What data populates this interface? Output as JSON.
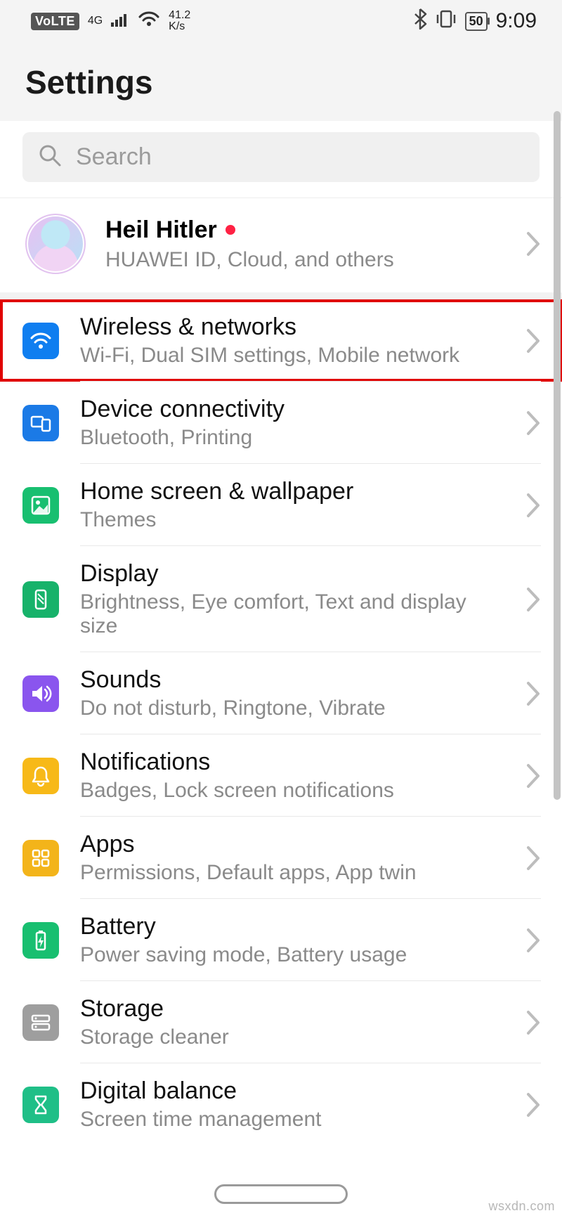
{
  "status": {
    "volte": "VoLTE",
    "signal_gen": "4G",
    "speed": "41.2",
    "speed_unit": "K/s",
    "battery": "50",
    "time": "9:09"
  },
  "header": {
    "title": "Settings"
  },
  "search": {
    "placeholder": "Search"
  },
  "account": {
    "name": "Heil Hitler",
    "subtitle": "HUAWEI ID, Cloud, and others"
  },
  "items": [
    {
      "title": "Wireless & networks",
      "subtitle": "Wi-Fi, Dual SIM settings, Mobile network"
    },
    {
      "title": "Device connectivity",
      "subtitle": "Bluetooth, Printing"
    },
    {
      "title": "Home screen & wallpaper",
      "subtitle": "Themes"
    },
    {
      "title": "Display",
      "subtitle": "Brightness, Eye comfort, Text and display size"
    },
    {
      "title": "Sounds",
      "subtitle": "Do not disturb, Ringtone, Vibrate"
    },
    {
      "title": "Notifications",
      "subtitle": "Badges, Lock screen notifications"
    },
    {
      "title": "Apps",
      "subtitle": "Permissions, Default apps, App twin"
    },
    {
      "title": "Battery",
      "subtitle": "Power saving mode, Battery usage"
    },
    {
      "title": "Storage",
      "subtitle": "Storage cleaner"
    },
    {
      "title": "Digital balance",
      "subtitle": "Screen time management"
    }
  ],
  "watermark": "wsxdn.com"
}
